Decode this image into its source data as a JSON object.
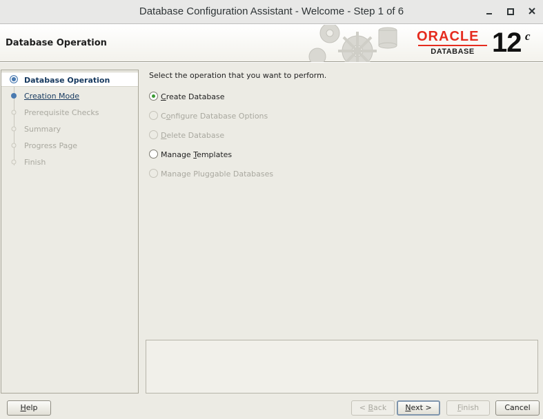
{
  "window": {
    "title": "Database Configuration Assistant - Welcome - Step 1 of 6",
    "controls": [
      "minimize-icon",
      "maximize-icon",
      "close-icon"
    ]
  },
  "header": {
    "page_title": "Database Operation",
    "brand": "ORACLE",
    "brand_sub": "DATABASE",
    "version": "12",
    "version_sup": "c",
    "brand_color": "#e52b1e"
  },
  "steps": [
    {
      "label": "Database Operation",
      "state": "active"
    },
    {
      "label": "Creation Mode",
      "state": "link"
    },
    {
      "label": "Prerequisite Checks",
      "state": "disabled"
    },
    {
      "label": "Summary",
      "state": "disabled"
    },
    {
      "label": "Progress Page",
      "state": "disabled"
    },
    {
      "label": "Finish",
      "state": "disabled"
    }
  ],
  "main": {
    "prompt": "Select the operation that you want to perform.",
    "options": [
      {
        "pre": "",
        "mnemonic": "C",
        "post": "reate Database",
        "checked": true,
        "enabled": true
      },
      {
        "pre": "C",
        "mnemonic": "o",
        "post": "nfigure Database Options",
        "checked": false,
        "enabled": false
      },
      {
        "pre": "",
        "mnemonic": "D",
        "post": "elete Database",
        "checked": false,
        "enabled": false
      },
      {
        "pre": "Manage ",
        "mnemonic": "T",
        "post": "emplates",
        "checked": false,
        "enabled": true
      },
      {
        "pre": "Manage Pluggable Databases",
        "mnemonic": "",
        "post": "",
        "checked": false,
        "enabled": false
      }
    ]
  },
  "buttons": {
    "help": {
      "pre": "",
      "mnemonic": "H",
      "post": "elp"
    },
    "back": {
      "pre": "< ",
      "mnemonic": "B",
      "post": "ack"
    },
    "next": {
      "pre": "",
      "mnemonic": "N",
      "post": "ext >"
    },
    "finish": {
      "pre": "",
      "mnemonic": "F",
      "post": "inish"
    },
    "cancel": {
      "pre": "Cancel",
      "mnemonic": "",
      "post": ""
    }
  },
  "colors": {
    "accent": "#15385e",
    "selected_radio": "#3a9a32",
    "panel_bg": "#ecebe4"
  }
}
